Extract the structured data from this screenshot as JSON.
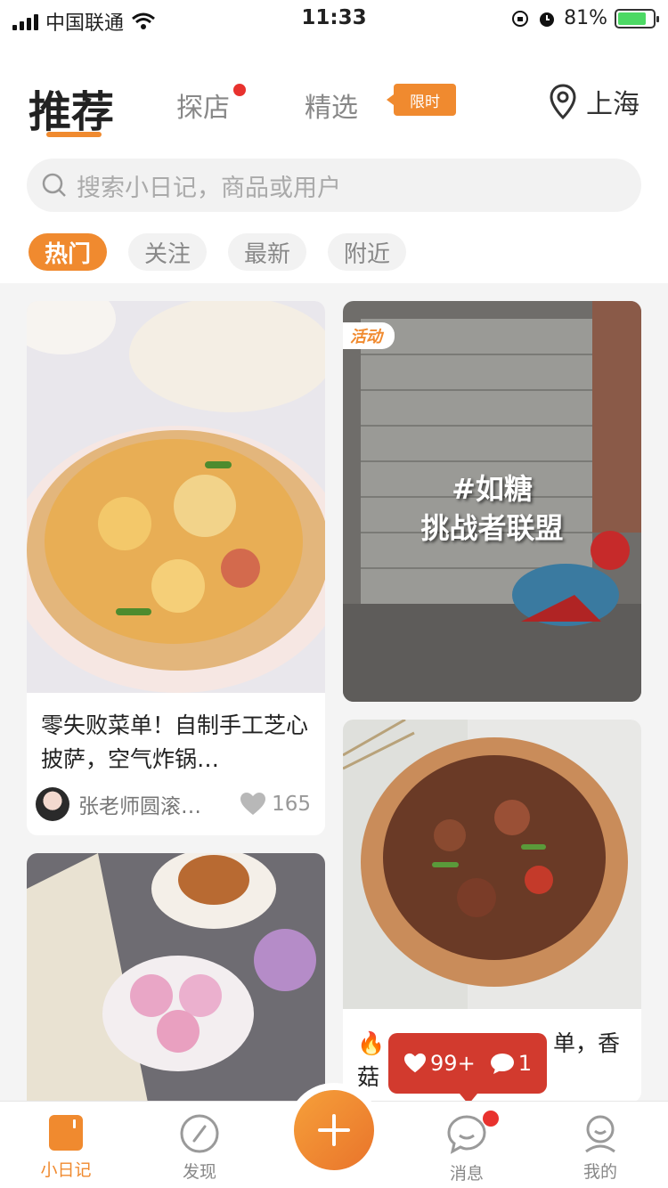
{
  "status_bar": {
    "carrier": "中国联通",
    "time": "11:33",
    "battery": "81%"
  },
  "header": {
    "tabs": {
      "recommend": "推荐",
      "visit_shop": "探店",
      "selected": "精选"
    },
    "limited_badge": "限时",
    "location": "上海"
  },
  "search": {
    "placeholder": "搜索小日记，商品或用户"
  },
  "filters": [
    "热门",
    "关注",
    "最新",
    "附近"
  ],
  "cards": {
    "pizza": {
      "title": "零失败菜单！自制手工芝心披萨，空气炸锅…",
      "author": "张老师圆滚…",
      "likes": "165"
    },
    "activity": {
      "tag": "活动",
      "line1": "#如糖",
      "line2": "挑战者联盟"
    },
    "mushroom": {
      "title_left": "🔥",
      "title_right": "单，香",
      "title_line2": "菇"
    }
  },
  "notification": {
    "likes": "99+",
    "comments": "1"
  },
  "bottom_nav": {
    "diary": "小日记",
    "discover": "发现",
    "messages": "消息",
    "mine": "我的"
  },
  "colors": {
    "accent": "#f08a2f",
    "red": "#d23a2e"
  }
}
